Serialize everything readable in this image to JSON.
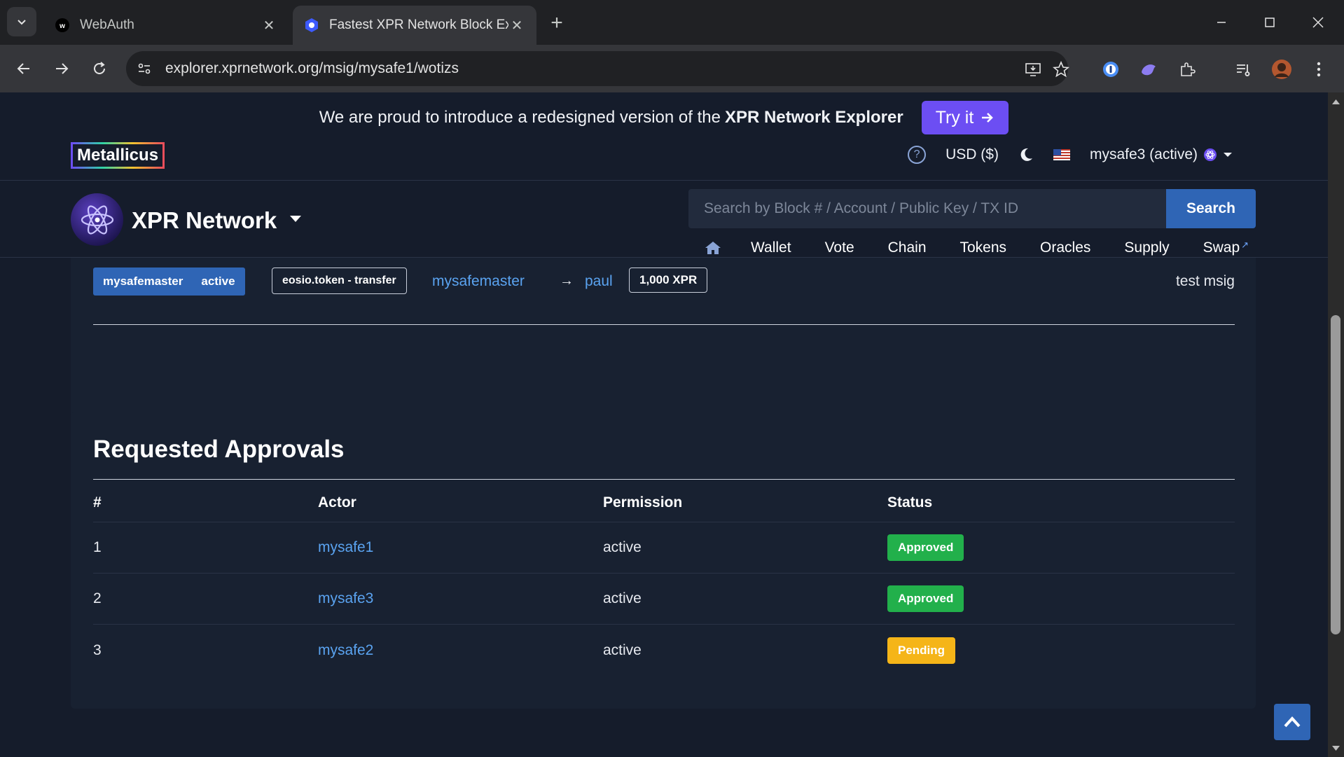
{
  "browser": {
    "tabs": [
      {
        "title": "WebAuth",
        "icon": "webauth-favicon"
      },
      {
        "title": "Fastest XPR Network Block Expl",
        "icon": "xpr-favicon"
      }
    ],
    "url": "explorer.xprnetwork.org/msig/mysafe1/wotizs"
  },
  "banner": {
    "text": "We are proud to introduce a redesigned version of the",
    "bold": "XPR Network Explorer",
    "button_label": "Try it"
  },
  "topbar": {
    "logo": "Metallicus",
    "currency": "USD ($)",
    "account": "mysafe3 (active)"
  },
  "header": {
    "brand": "XPR Network",
    "search_placeholder": "Search by Block # / Account / Public Key / TX ID",
    "search_button": "Search",
    "nav": [
      "Wallet",
      "Vote",
      "Chain",
      "Tokens",
      "Oracles",
      "Supply",
      "Swap"
    ]
  },
  "action": {
    "actor": "mysafemaster",
    "permission": "active",
    "contract_action": "eosio.token - transfer",
    "from": "mysafemaster",
    "arrow": "→",
    "to": "paul",
    "amount": "1,000 XPR",
    "memo": "test msig"
  },
  "approvals": {
    "title": "Requested Approvals",
    "columns": [
      "#",
      "Actor",
      "Permission",
      "Status"
    ],
    "rows": [
      {
        "num": "1",
        "actor": "mysafe1",
        "permission": "active",
        "status": "Approved"
      },
      {
        "num": "2",
        "actor": "mysafe3",
        "permission": "active",
        "status": "Approved"
      },
      {
        "num": "3",
        "actor": "mysafe2",
        "permission": "active",
        "status": "Pending"
      }
    ]
  },
  "colors": {
    "accent": "#2f65b5",
    "try_button": "#6c4ef3",
    "approved": "#22b04b",
    "pending": "#f5b518",
    "link": "#5aa3f0",
    "page_bg": "#151c2b",
    "card_bg": "#182131"
  }
}
